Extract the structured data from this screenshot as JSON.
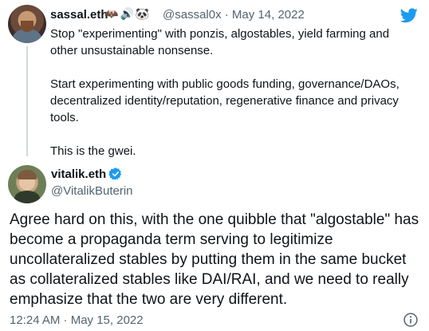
{
  "quoted_tweet": {
    "author_name": "sassal.eth",
    "name_emojis": [
      "🦇",
      "🔊",
      "🐼"
    ],
    "handle_date": "@sassal0x · May 14, 2022",
    "paragraphs": [
      "Stop \"experimenting\" with ponzis, algostables, yield farming and other unsustainable nonsense.",
      "Start experimenting with public goods funding, governance/DAOs, decentralized identity/reputation, regenerative finance and privacy tools.",
      "This is the gwei."
    ]
  },
  "main_tweet": {
    "author_name": "vitalik.eth",
    "handle": "@VitalikButerin",
    "text": "Agree hard on this, with the one quibble that \"algostable\" has become a propaganda term serving to legitimize uncollateralized stables by putting them in the same bucket as collateralized stables like DAI/RAI, and we need to really emphasize that the two are very different.",
    "timestamp": "12:24 AM · May 15, 2022"
  },
  "icons": {
    "brand": "twitter-bird-icon",
    "verified": "verified-badge-icon",
    "info": "info-icon"
  },
  "colors": {
    "brand_blue": "#1d9bf0",
    "text_primary": "#0f1419",
    "text_secondary": "#536471",
    "thread_line": "#cfd9de"
  }
}
